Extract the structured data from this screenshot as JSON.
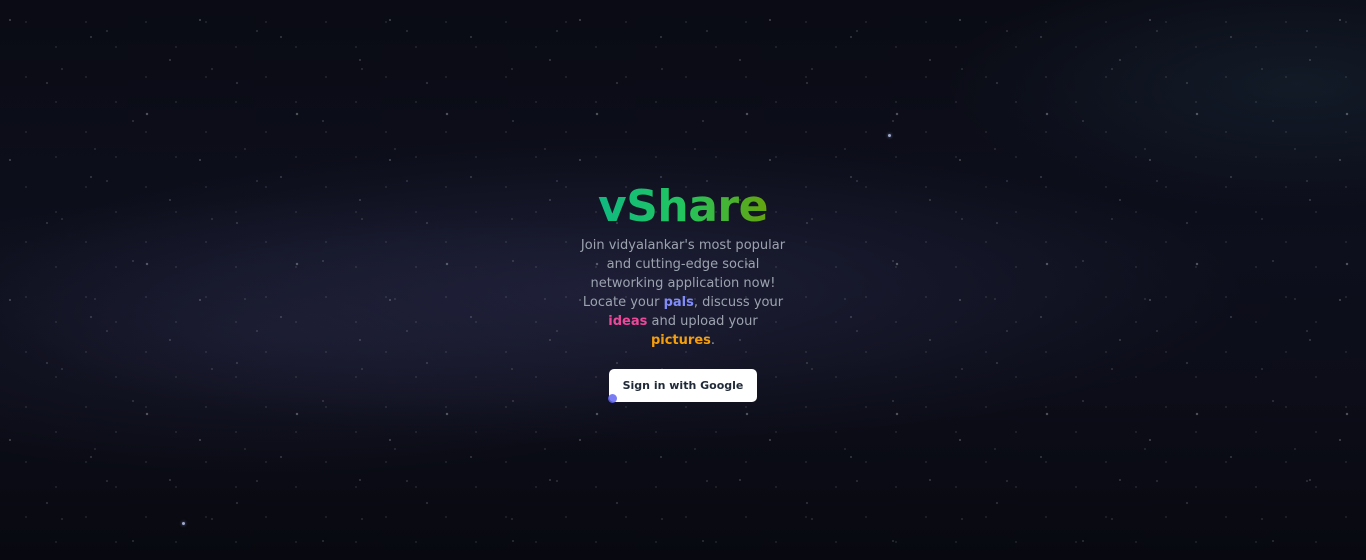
{
  "app": {
    "name": "vShare"
  },
  "hero": {
    "tagline_part1": "Join vidyalankar's most popular and cutting-edge social networking application now! Locate your ",
    "highlight_pals": "pals",
    "tagline_part2": ", discuss your ",
    "highlight_ideas": "ideas",
    "tagline_part3": " and upload your ",
    "highlight_pictures": "pictures",
    "tagline_part4": "."
  },
  "auth": {
    "google_button_label": "Sign in with Google"
  },
  "colors": {
    "brand_gradient_start": "#10b981",
    "brand_gradient_end": "#65a30d",
    "pals": "#818cf8",
    "ideas": "#ec4899",
    "pictures": "#f59e0b",
    "button_bg": "#ffffff",
    "indicator": "#6366f1"
  },
  "background": {
    "icon": "starfield-background"
  }
}
